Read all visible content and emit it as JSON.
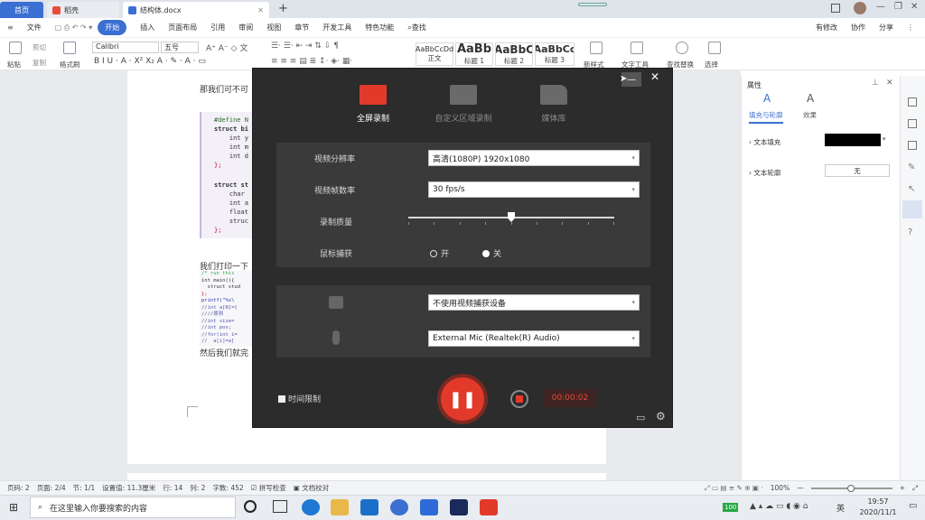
{
  "tabs": {
    "home": "首页",
    "daoke": "稻壳",
    "doc": "结构体.docx",
    "new_tab": "+"
  },
  "menu": {
    "file": "文件",
    "items": [
      "开始",
      "插入",
      "页面布局",
      "引用",
      "审阅",
      "视图",
      "章节",
      "开发工具",
      "特色功能"
    ],
    "search": "查找",
    "right": [
      "有修改",
      "协作",
      "分享"
    ]
  },
  "ribbon": {
    "paste": "粘贴",
    "cut": "剪切",
    "copy": "复制",
    "format_painter": "格式刷",
    "font": "Calibri",
    "size": "五号",
    "styles": [
      {
        "sample": "AaBbCcDd",
        "name": "正文"
      },
      {
        "sample": "AaBb",
        "name": "标题 1"
      },
      {
        "sample": "AaBbC",
        "name": "标题 2"
      },
      {
        "sample": "AaBbCc",
        "name": "标题 3"
      }
    ],
    "new_style": "新样式",
    "text_tools": "文字工具",
    "find_replace": "查找替换",
    "select": "选择"
  },
  "doc": {
    "line1": "那我们可不可",
    "code1": [
      "#define N",
      "struct bi",
      "    int y",
      "    int m",
      "    int d",
      "};",
      "",
      "struct st",
      "    char",
      "    int a",
      "    float",
      "    struc",
      "};"
    ],
    "line2": "我们打印一下",
    "code2": [
      "/* run this",
      "int main(){",
      "  struct stud",
      "};",
      "printf(\"%s\\",
      "//int a[N]={",
      "////原则",
      "//int size=",
      "//int pos;",
      "//for(int i=",
      "//  a[i]=a["
    ],
    "line3": "然后我们就完"
  },
  "panel": {
    "title": "属性",
    "tab1": "填充与轮廓",
    "tab2": "效果",
    "fill_label": "文本填充",
    "outline_label": "文本轮廓",
    "outline_value": "无",
    "fill_color": "#000000"
  },
  "recorder": {
    "tabs": [
      "全屏录制",
      "自定义区域录制",
      "媒体库"
    ],
    "resolution_label": "视频分辨率",
    "resolution_value": "高清(1080P)   1920x1080",
    "framerate_label": "视频帧数率",
    "framerate_value": "30 fps/s",
    "quality_label": "录制质量",
    "quality_level": 0.5,
    "cursor_label": "鼠标捕获",
    "cursor_on": "开",
    "cursor_off": "关",
    "cursor_selected": "off",
    "camera_value": "不使用视频捕获设备",
    "mic_value": "External Mic (Realtek(R) Audio)",
    "time_limit": "时间限制",
    "timer": "00:00:02",
    "accent": "#e23a2a"
  },
  "status": {
    "items": [
      "页码: 2",
      "页面: 2/4",
      "节: 1/1",
      "设置值: 11.3厘米",
      "行: 14",
      "列: 2",
      "字数: 452",
      "拼写检查",
      "文档校对"
    ],
    "zoom": "100%"
  },
  "taskbar": {
    "search_placeholder": "在这里输入你要搜索的内容",
    "battery": "100",
    "lang": "英",
    "time": "19:57",
    "date": "2020/11/1"
  }
}
